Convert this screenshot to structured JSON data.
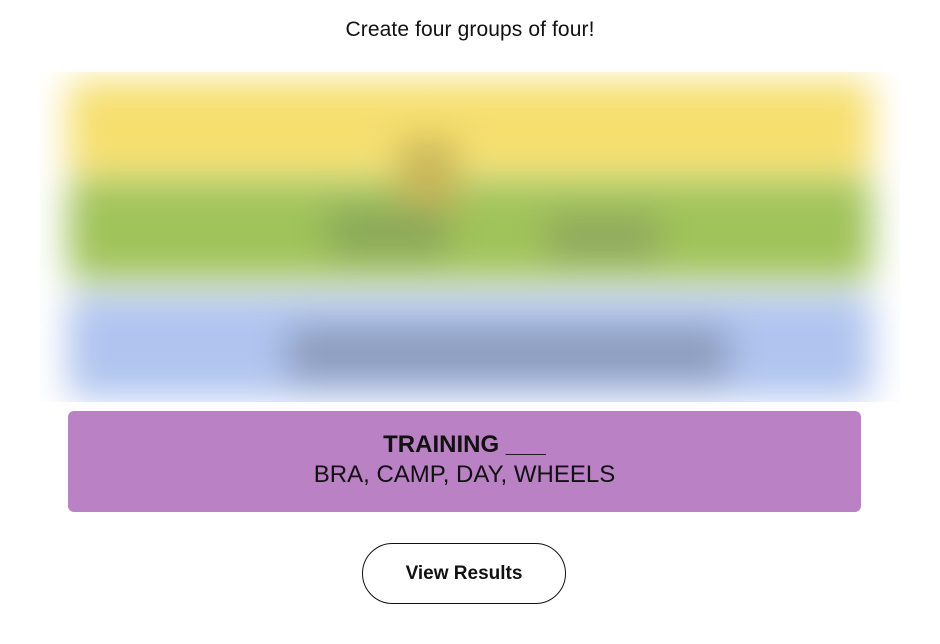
{
  "header": {
    "prompt": "Create four groups of four!"
  },
  "solved_group": {
    "title": "TRAINING ___",
    "members": "BRA, CAMP, DAY, WHEELS",
    "color": "#ba81c5"
  },
  "obscured_groups": {
    "colors": [
      "#f6df6f",
      "#a0c35a",
      "#b0c4ef"
    ]
  },
  "actions": {
    "view_results_label": "View Results"
  }
}
